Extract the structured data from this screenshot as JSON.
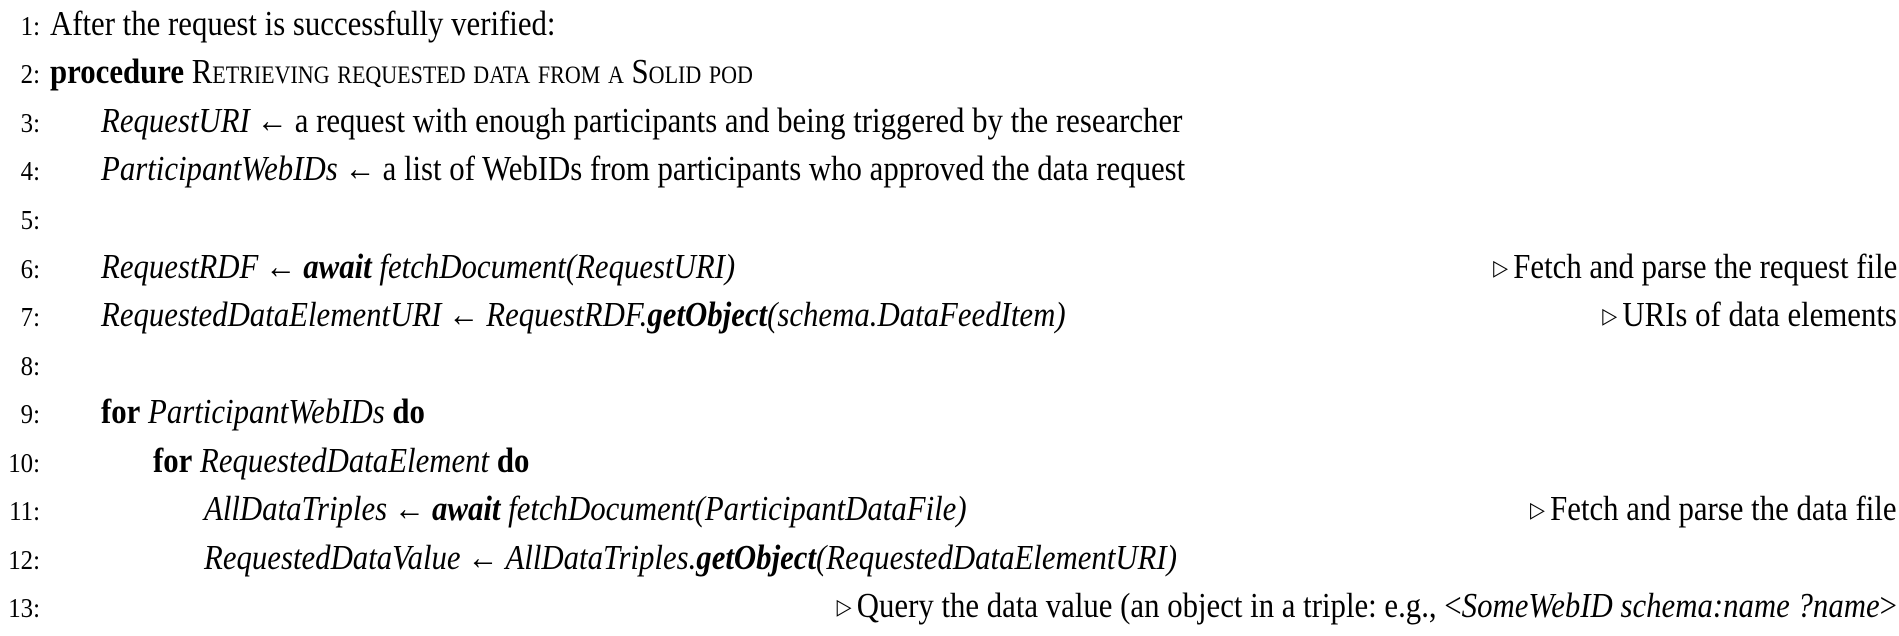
{
  "algorithm": {
    "arrow_symbol": "←",
    "comment_icon": "▷",
    "lines": [
      {
        "num": "1:",
        "text": "After the request is successfully verified:"
      },
      {
        "num": "2:",
        "keyword": "procedure",
        "name": "Retrieving requested data from a Solid pod"
      },
      {
        "num": "3:",
        "var": "RequestURI",
        "text": "a request with enough participants and being triggered by the researcher"
      },
      {
        "num": "4:",
        "var": "ParticipantWebIDs",
        "text": "a list of WebIDs from participants who approved the data request"
      },
      {
        "num": "5:"
      },
      {
        "num": "6:",
        "var": "RequestRDF",
        "keyword": "await",
        "call": "fetchDocument(RequestURI)",
        "comment": "Fetch and parse the request file"
      },
      {
        "num": "7:",
        "var": "RequestedDataElementURI",
        "obj": "RequestRDF.",
        "method": "getObject",
        "args": "(schema.DataFeedItem)",
        "comment": "URIs of data elements"
      },
      {
        "num": "8:"
      },
      {
        "num": "9:",
        "kw_for": "for",
        "var": "ParticipantWebIDs",
        "kw_do": "do"
      },
      {
        "num": "10:",
        "kw_for": "for",
        "var": "RequestedDataElement",
        "kw_do": "do"
      },
      {
        "num": "11:",
        "var": "AllDataTriples",
        "keyword": "await",
        "call": "fetchDocument(ParticipantDataFile)",
        "comment": "Fetch and parse the data file"
      },
      {
        "num": "12:",
        "var": "RequestedDataValue",
        "obj": "AllDataTriples.",
        "method": "getObject",
        "args": "(RequestedDataElementURI)"
      },
      {
        "num": "13:",
        "comment_prefix": "Query the data value (an object in a triple: e.g., <",
        "comment_italic": "SomeWebID schema:name ?name",
        "comment_suffix": ">"
      }
    ]
  }
}
